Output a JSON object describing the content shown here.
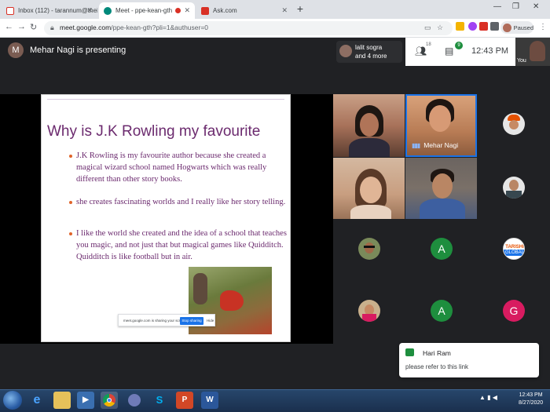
{
  "browser": {
    "tabs": [
      {
        "label": "Inbox (112) - tarannum@theindi",
        "favicon": "gmail-icon"
      },
      {
        "label": "Meet - ppe-kean-gth",
        "favicon": "meet-icon"
      },
      {
        "label": "Ask.com",
        "favicon": "ask-icon"
      }
    ],
    "new_tab": "+",
    "url_host": "meet.google.com",
    "url_path": "/ppe-kean-gth?pli=1&authuser=0",
    "profile_status": "Paused"
  },
  "meet": {
    "presenter_initial": "M",
    "presenter_label": "Mehar Nagi is presenting",
    "participants_line1": "lalit sogra",
    "participants_line2": "and 4 more",
    "people_count": "18",
    "chat_count": "9",
    "clock": "12:43  PM",
    "self_label": "You"
  },
  "slide": {
    "title": "Why is J.K Rowling my favourite",
    "bullets": [
      "J.K Rowling is my favourite author because she created a magical wizard school named Hogwarts which was really different than other story books.",
      "she creates fascinating worlds and I really like her story telling.",
      "I like the world she created and the idea of a school that teaches you magic, and not just that but magical games like Quidditch. Quidditch is like football but in air."
    ],
    "share_text": "meet.google.com is sharing your screen.",
    "stop_label": "Stop sharing",
    "hide_label": "Hide"
  },
  "tiles": {
    "speaker_name": "Mehar Nagi",
    "avatar_a1": "A",
    "avatar_a2": "A",
    "avatar_g": "G",
    "tarishi_line1": "TARISHI",
    "tarishi_line2": "GLOBAL"
  },
  "toast": {
    "name": "Hari Ram",
    "message": "please refer to this link"
  },
  "taskbar": {
    "time": "12:43 PM",
    "date": "8/27/2020"
  },
  "colors": {
    "slide_title": "#6b2a6e",
    "bullet": "#e0642a",
    "avatar_green": "#1e8e3e",
    "avatar_pink": "#d81b60",
    "meet_blue": "#1a73e8"
  }
}
